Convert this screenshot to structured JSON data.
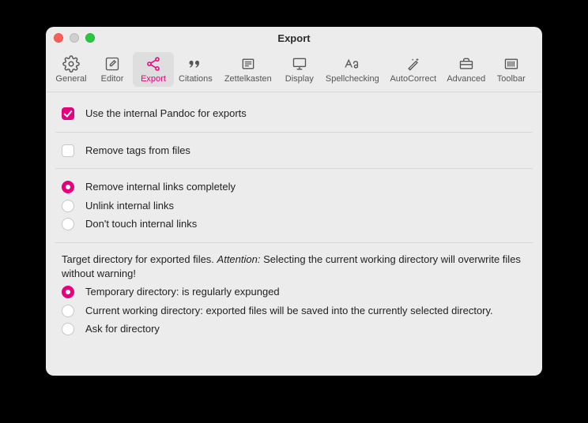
{
  "window": {
    "title": "Export"
  },
  "tabs": {
    "general": "General",
    "editor": "Editor",
    "export": "Export",
    "citations": "Citations",
    "zettelkasten": "Zettelkasten",
    "display": "Display",
    "spellchecking": "Spellchecking",
    "autocorrect": "AutoCorrect",
    "advanced": "Advanced",
    "toolbar": "Toolbar"
  },
  "options": {
    "use_internal_pandoc": "Use the internal Pandoc for exports",
    "remove_tags": "Remove tags from files"
  },
  "links": {
    "remove": "Remove internal links completely",
    "unlink": "Unlink internal links",
    "dont_touch": "Don't touch internal links"
  },
  "target": {
    "desc_prefix": "Target directory for exported files. ",
    "desc_attention": "Attention:",
    "desc_suffix": " Selecting the current working directory will overwrite files without warning!",
    "temp": "Temporary directory: is regularly expunged",
    "cwd": "Current working directory: exported files will be saved into the currently selected directory.",
    "ask": "Ask for directory"
  }
}
